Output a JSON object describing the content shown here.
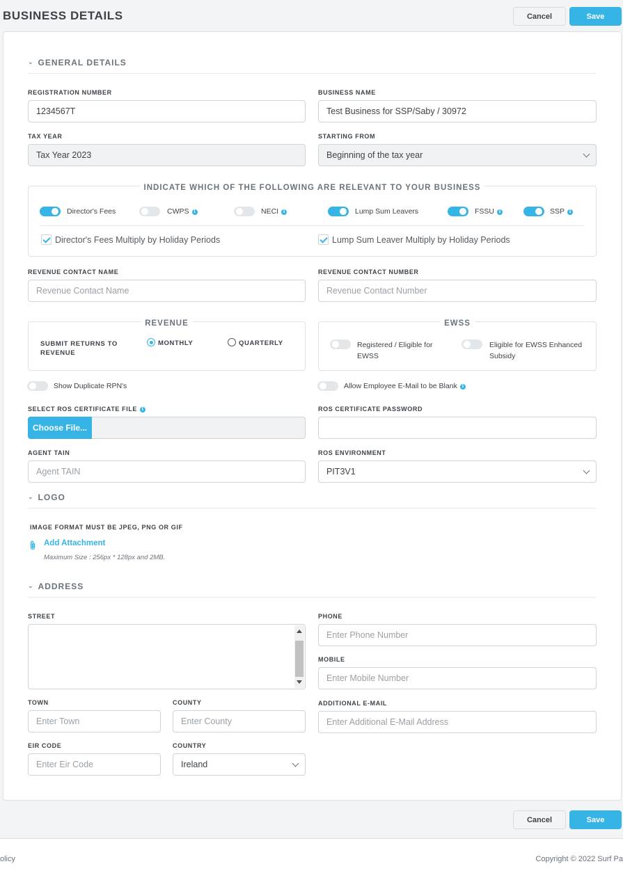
{
  "header": {
    "title": "BUSINESS DETAILS",
    "cancel_label": "Cancel",
    "save_label": "Save"
  },
  "general": {
    "section_title": "GENERAL DETAILS",
    "registration_number": {
      "label": "REGISTRATION NUMBER",
      "value": "1234567T"
    },
    "business_name": {
      "label": "BUSINESS NAME",
      "value": "Test Business for SSP/Saby / 30972"
    },
    "tax_year": {
      "label": "TAX YEAR",
      "value": "Tax Year 2023"
    },
    "starting_from": {
      "label": "STARTING FROM",
      "value": "Beginning of the tax year"
    },
    "relevant": {
      "legend": "INDICATE WHICH OF THE FOLLOWING ARE RELEVANT TO YOUR BUSINESS",
      "toggles": [
        {
          "label": "Director's Fees",
          "on": true
        },
        {
          "label": "CWPS",
          "on": false
        },
        {
          "label": "NECI",
          "on": false
        },
        {
          "label": "Lump Sum Leavers",
          "on": true
        },
        {
          "label": "FSSU",
          "on": true
        },
        {
          "label": "SSP",
          "on": true
        }
      ],
      "checkboxes": [
        {
          "label": "Director's Fees Multiply by Holiday Periods",
          "checked": true
        },
        {
          "label": "Lump Sum Leaver Multiply by Holiday Periods",
          "checked": true
        }
      ]
    },
    "revenue_contact_name": {
      "label": "REVENUE CONTACT NAME",
      "placeholder": "Revenue Contact Name"
    },
    "revenue_contact_number": {
      "label": "REVENUE CONTACT NUMBER",
      "placeholder": "Revenue Contact Number"
    },
    "revenue": {
      "legend": "REVENUE",
      "submit_label": "SUBMIT RETURNS TO REVENUE",
      "monthly": "MONTHLY",
      "quarterly": "QUARTERLY",
      "selected": "MONTHLY"
    },
    "ewss": {
      "legend": "EWSS",
      "registered": "Registered / Eligible for EWSS",
      "enhanced": "Eligible for EWSS Enhanced Subsidy"
    },
    "show_duplicate": "Show Duplicate RPN's",
    "allow_blank_email": "Allow Employee E-Mail to be Blank",
    "ros_cert_file": {
      "label": "SELECT ROS CERTIFICATE FILE",
      "button": "Choose File..."
    },
    "ros_cert_password": {
      "label": "ROS CERTIFICATE PASSWORD"
    },
    "agent_tain": {
      "label": "AGENT TAIN",
      "placeholder": "Agent TAIN"
    },
    "ros_environment": {
      "label": "ROS ENVIRONMENT",
      "value": "PIT3V1"
    }
  },
  "logo": {
    "section_title": "LOGO",
    "format_note": "IMAGE FORMAT MUST BE JPEG, PNG OR GIF",
    "add_attachment": "Add Attachment",
    "max_size": "Maximum Size : 256px * 128px and 2MB."
  },
  "address": {
    "section_title": "ADDRESS",
    "street": {
      "label": "STREET"
    },
    "phone": {
      "label": "PHONE",
      "placeholder": "Enter Phone Number"
    },
    "mobile": {
      "label": "MOBILE",
      "placeholder": "Enter Mobile Number"
    },
    "town": {
      "label": "TOWN",
      "placeholder": "Enter Town"
    },
    "county": {
      "label": "COUNTY",
      "placeholder": "Enter County"
    },
    "additional_email": {
      "label": "ADDITIONAL E-MAIL",
      "placeholder": "Enter Additional E-Mail Address"
    },
    "eir_code": {
      "label": "EIR CODE",
      "placeholder": "Enter Eir Code"
    },
    "country": {
      "label": "COUNTRY",
      "value": "Ireland"
    }
  },
  "footer": {
    "left": "olicy",
    "right": "Copyright © 2022 Surf Pa"
  },
  "colors": {
    "accent": "#36b4e5",
    "text": "#3d4349",
    "border": "#cfd4d8"
  }
}
